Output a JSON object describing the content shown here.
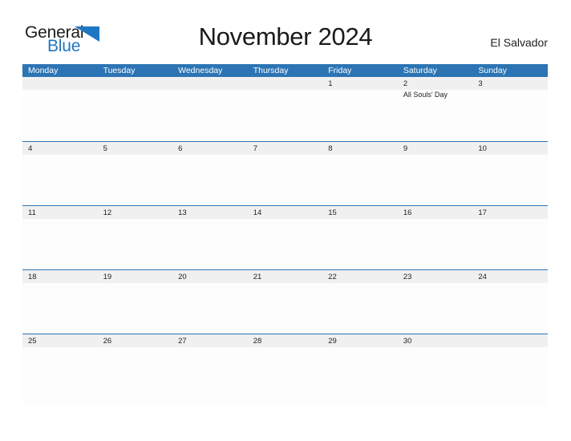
{
  "brand": {
    "name_part1": "General",
    "name_part2": "Blue",
    "flag_icon": "blue-triangle-flag-icon",
    "color_primary": "#1f77c4",
    "color_text": "#1b1b1b"
  },
  "header": {
    "title": "November 2024",
    "country": "El Salvador"
  },
  "theme": {
    "header_bar_color": "#2c74b3",
    "band_color": "#f0f0f0",
    "row_line_color": "#2c74b3",
    "page_background": "#ffffff"
  },
  "calendar": {
    "month": "November",
    "year": "2024",
    "weekday_headers": [
      "Monday",
      "Tuesday",
      "Wednesday",
      "Thursday",
      "Friday",
      "Saturday",
      "Sunday"
    ],
    "weeks": [
      {
        "days": [
          {
            "date": "",
            "shaded": false,
            "events": []
          },
          {
            "date": "",
            "shaded": false,
            "events": []
          },
          {
            "date": "",
            "shaded": false,
            "events": []
          },
          {
            "date": "",
            "shaded": false,
            "events": []
          },
          {
            "date": "1",
            "shaded": true,
            "events": []
          },
          {
            "date": "2",
            "shaded": true,
            "events": [
              "All Souls' Day"
            ]
          },
          {
            "date": "3",
            "shaded": true,
            "events": []
          }
        ]
      },
      {
        "days": [
          {
            "date": "4",
            "shaded": true,
            "events": []
          },
          {
            "date": "5",
            "shaded": true,
            "events": []
          },
          {
            "date": "6",
            "shaded": true,
            "events": []
          },
          {
            "date": "7",
            "shaded": true,
            "events": []
          },
          {
            "date": "8",
            "shaded": true,
            "events": []
          },
          {
            "date": "9",
            "shaded": true,
            "events": []
          },
          {
            "date": "10",
            "shaded": true,
            "events": []
          }
        ]
      },
      {
        "days": [
          {
            "date": "11",
            "shaded": true,
            "events": []
          },
          {
            "date": "12",
            "shaded": true,
            "events": []
          },
          {
            "date": "13",
            "shaded": true,
            "events": []
          },
          {
            "date": "14",
            "shaded": true,
            "events": []
          },
          {
            "date": "15",
            "shaded": true,
            "events": []
          },
          {
            "date": "16",
            "shaded": true,
            "events": []
          },
          {
            "date": "17",
            "shaded": true,
            "events": []
          }
        ]
      },
      {
        "days": [
          {
            "date": "18",
            "shaded": true,
            "events": []
          },
          {
            "date": "19",
            "shaded": true,
            "events": []
          },
          {
            "date": "20",
            "shaded": true,
            "events": []
          },
          {
            "date": "21",
            "shaded": true,
            "events": []
          },
          {
            "date": "22",
            "shaded": true,
            "events": []
          },
          {
            "date": "23",
            "shaded": true,
            "events": []
          },
          {
            "date": "24",
            "shaded": true,
            "events": []
          }
        ]
      },
      {
        "days": [
          {
            "date": "25",
            "shaded": true,
            "events": []
          },
          {
            "date": "26",
            "shaded": true,
            "events": []
          },
          {
            "date": "27",
            "shaded": true,
            "events": []
          },
          {
            "date": "28",
            "shaded": true,
            "events": []
          },
          {
            "date": "29",
            "shaded": true,
            "events": []
          },
          {
            "date": "30",
            "shaded": true,
            "events": []
          },
          {
            "date": "",
            "shaded": true,
            "events": []
          }
        ]
      }
    ]
  }
}
